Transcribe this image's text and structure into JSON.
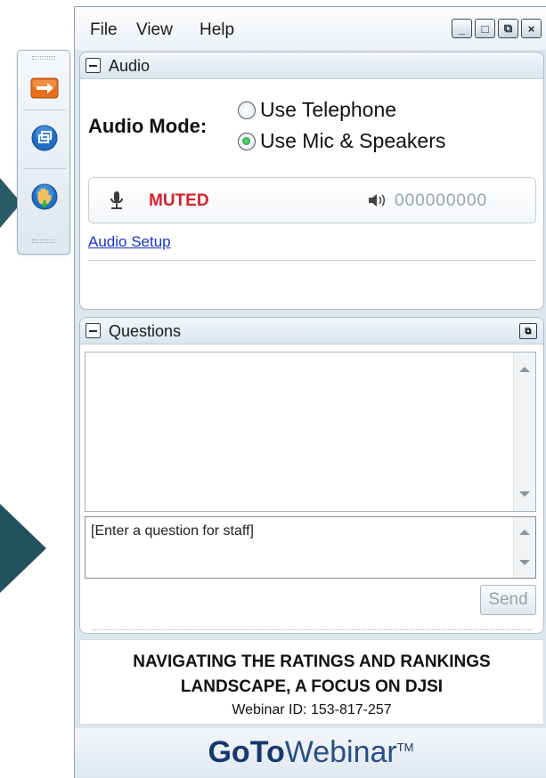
{
  "menu": {
    "file": "File",
    "view": "View",
    "help": "Help"
  },
  "window_buttons": {
    "minimize": "_",
    "restore": "□",
    "popout": "⧉",
    "close": "×"
  },
  "audio_panel": {
    "title": "Audio",
    "mode_label": "Audio Mode:",
    "options": [
      {
        "label": "Use Telephone",
        "selected": false
      },
      {
        "label": "Use Mic & Speakers",
        "selected": true
      }
    ],
    "mic_status": "MUTED",
    "speaker_level": "000000000",
    "setup_link": "Audio Setup"
  },
  "questions_panel": {
    "title": "Questions",
    "input_placeholder": "[Enter a question for staff]",
    "send_label": "Send"
  },
  "webinar": {
    "title_line1": "NAVIGATING THE RATINGS AND RANKINGS",
    "title_line2": "LANDSCAPE, A FOCUS ON DJSI",
    "id_text": "Webinar ID: 153-817-257"
  },
  "brand": {
    "goto": "GoTo",
    "webinar": "Webinar",
    "tm": "TM"
  },
  "colors": {
    "muted": "#d6222a",
    "link": "#1b33c9",
    "brand": "#16386e",
    "arrow": "#22525e"
  }
}
